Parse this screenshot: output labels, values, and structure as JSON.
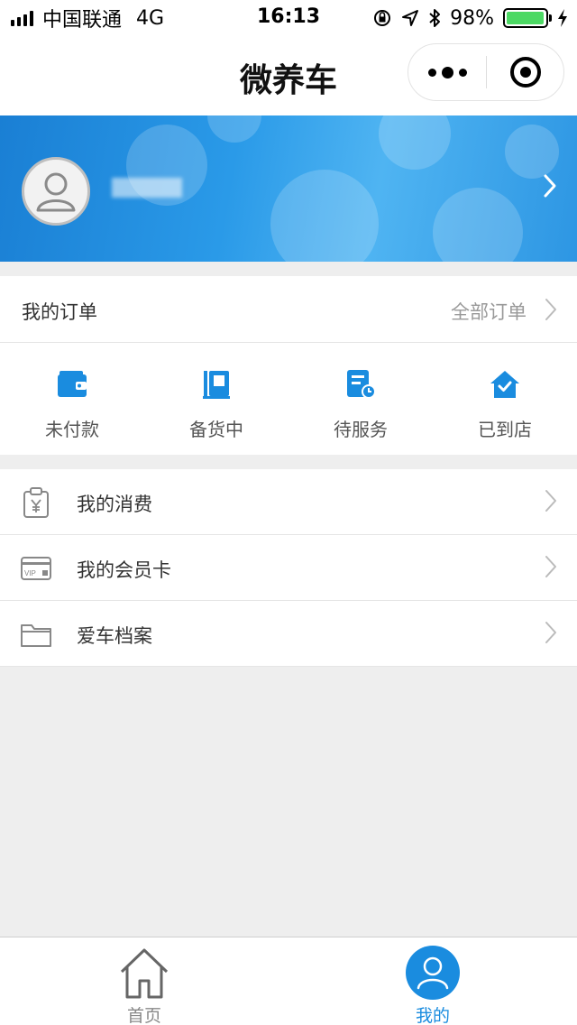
{
  "status_bar": {
    "carrier": "中国联通",
    "network": "4G",
    "time": "16:13",
    "battery_percent": "98%",
    "battery_level": 0.98
  },
  "nav": {
    "title": "微养车"
  },
  "colors": {
    "accent": "#1a8cdf",
    "banner": "#2a9ae8",
    "battery_green": "#4cd964"
  },
  "orders": {
    "title": "我的订单",
    "all_label": "全部订单",
    "items": [
      {
        "label": "未付款",
        "icon": "wallet-icon"
      },
      {
        "label": "备货中",
        "icon": "stock-book-icon"
      },
      {
        "label": "待服务",
        "icon": "service-clock-icon"
      },
      {
        "label": "已到店",
        "icon": "store-house-icon"
      }
    ]
  },
  "menu": {
    "items": [
      {
        "label": "我的消费",
        "icon": "receipt-yen-icon"
      },
      {
        "label": "我的会员卡",
        "icon": "vip-card-icon"
      },
      {
        "label": "爱车档案",
        "icon": "folder-icon"
      }
    ],
    "vip_text": "VIP"
  },
  "tabbar": {
    "items": [
      {
        "label": "首页",
        "icon": "home-icon",
        "active": false
      },
      {
        "label": "我的",
        "icon": "user-icon",
        "active": true
      }
    ]
  }
}
